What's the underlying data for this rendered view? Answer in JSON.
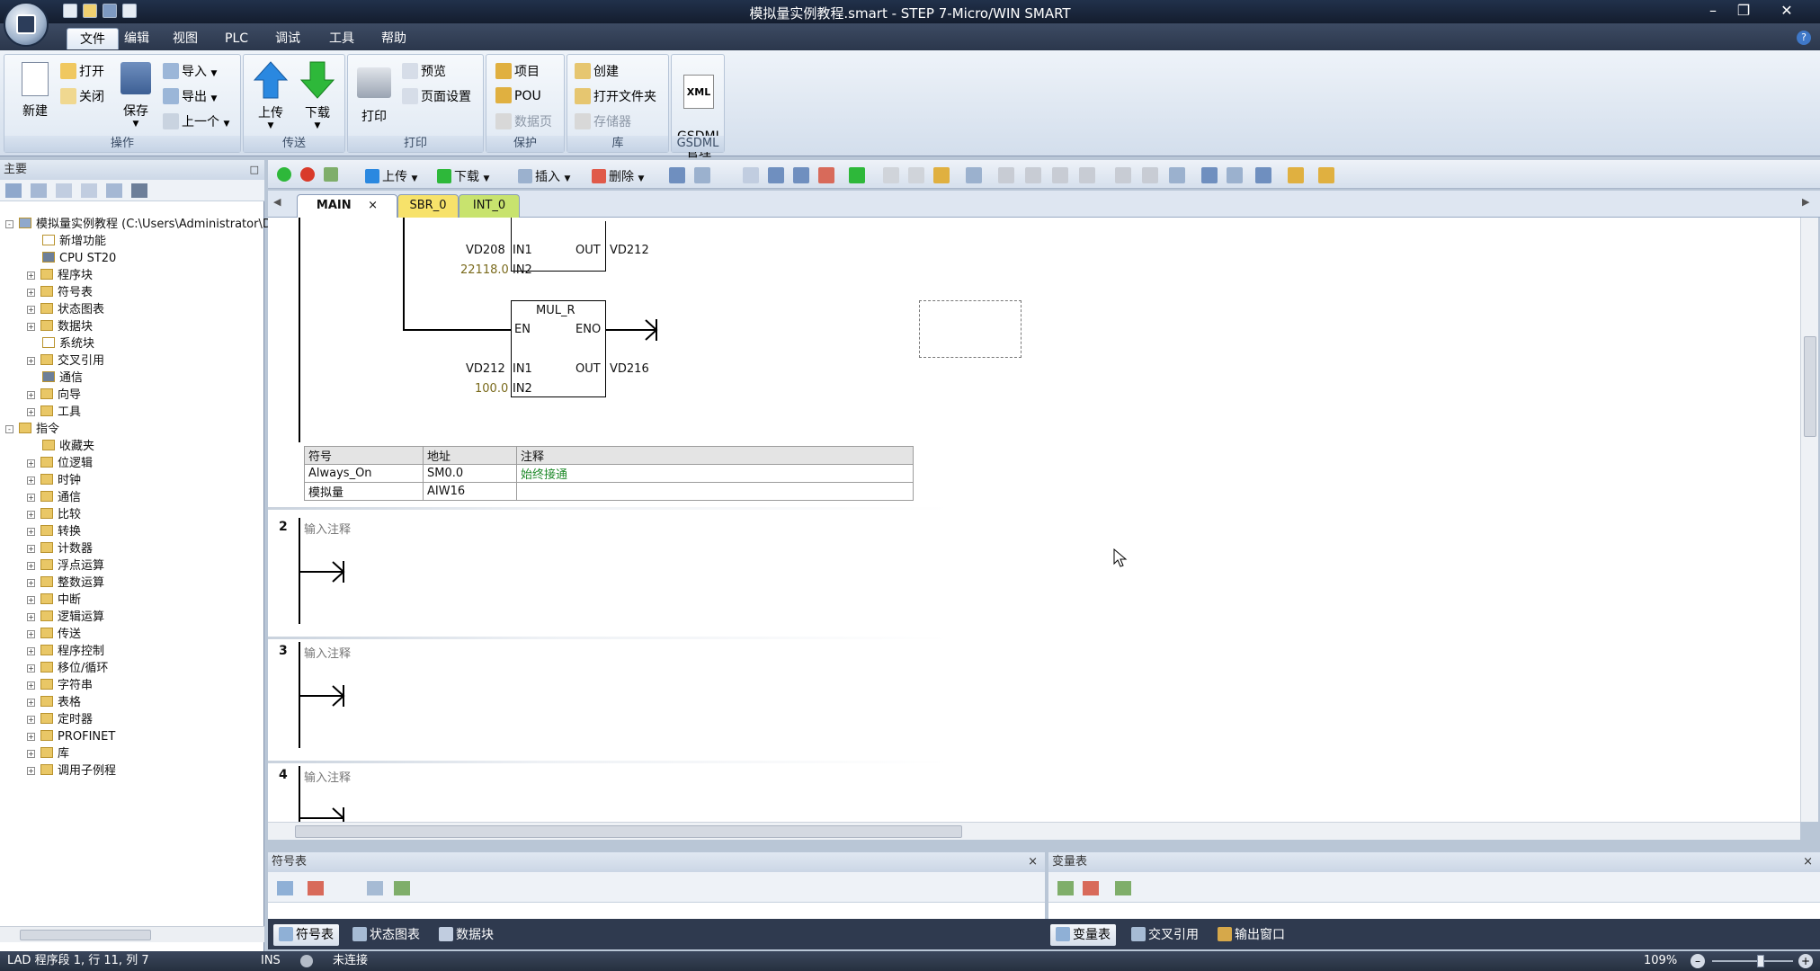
{
  "window": {
    "title": "模拟量实例教程.smart - STEP 7-Micro/WIN SMART"
  },
  "menu": {
    "tabs": [
      "文件",
      "编辑",
      "视图",
      "PLC",
      "调试",
      "工具",
      "帮助"
    ]
  },
  "ribbon": {
    "groups": {
      "operate": "操作",
      "transfer": "传送",
      "print": "打印",
      "protect": "保护",
      "library": "库",
      "gsdml": "GSDML"
    },
    "buttons": {
      "new": "新建",
      "open": "打开",
      "close": "关闭",
      "save": "保存",
      "import": "导入",
      "export": "导出",
      "previous": "上一个",
      "upload": "上传",
      "download": "下载",
      "print": "打印",
      "preview": "预览",
      "page_setup": "页面设置",
      "project": "项目",
      "pou": "POU",
      "data_page": "数据页",
      "create": "创建",
      "open_folder": "打开文件夹",
      "memory": "存储器",
      "gsdml_mgmt": "GSDML\n管理",
      "gsdml_xml": "XML"
    }
  },
  "left_panel": {
    "title": "主要",
    "tree": [
      {
        "label": "模拟量实例教程 (C:\\Users\\Administrator\\D",
        "level": 0,
        "expander": "-",
        "icon": "project"
      },
      {
        "label": "新增功能",
        "level": 1,
        "expander": "",
        "icon": "help"
      },
      {
        "label": "CPU ST20",
        "level": 1,
        "expander": "",
        "icon": "cpu"
      },
      {
        "label": "程序块",
        "level": 1,
        "expander": "+",
        "icon": "folder"
      },
      {
        "label": "符号表",
        "level": 1,
        "expander": "+",
        "icon": "folder"
      },
      {
        "label": "状态图表",
        "level": 1,
        "expander": "+",
        "icon": "folder"
      },
      {
        "label": "数据块",
        "level": 1,
        "expander": "+",
        "icon": "folder"
      },
      {
        "label": "系统块",
        "level": 1,
        "expander": "",
        "icon": "doc"
      },
      {
        "label": "交叉引用",
        "level": 1,
        "expander": "+",
        "icon": "folder"
      },
      {
        "label": "通信",
        "level": 1,
        "expander": "",
        "icon": "comm"
      },
      {
        "label": "向导",
        "level": 1,
        "expander": "+",
        "icon": "folder"
      },
      {
        "label": "工具",
        "level": 1,
        "expander": "+",
        "icon": "folder"
      },
      {
        "label": "指令",
        "level": 0,
        "expander": "-",
        "icon": "folder"
      },
      {
        "label": "收藏夹",
        "level": 1,
        "expander": "",
        "icon": "folder"
      },
      {
        "label": "位逻辑",
        "level": 1,
        "expander": "+",
        "icon": "folder"
      },
      {
        "label": "时钟",
        "level": 1,
        "expander": "+",
        "icon": "folder"
      },
      {
        "label": "通信",
        "level": 1,
        "expander": "+",
        "icon": "folder"
      },
      {
        "label": "比较",
        "level": 1,
        "expander": "+",
        "icon": "folder"
      },
      {
        "label": "转换",
        "level": 1,
        "expander": "+",
        "icon": "folder"
      },
      {
        "label": "计数器",
        "level": 1,
        "expander": "+",
        "icon": "folder"
      },
      {
        "label": "浮点运算",
        "level": 1,
        "expander": "+",
        "icon": "folder"
      },
      {
        "label": "整数运算",
        "level": 1,
        "expander": "+",
        "icon": "folder"
      },
      {
        "label": "中断",
        "level": 1,
        "expander": "+",
        "icon": "folder"
      },
      {
        "label": "逻辑运算",
        "level": 1,
        "expander": "+",
        "icon": "folder"
      },
      {
        "label": "传送",
        "level": 1,
        "expander": "+",
        "icon": "folder"
      },
      {
        "label": "程序控制",
        "level": 1,
        "expander": "+",
        "icon": "folder"
      },
      {
        "label": "移位/循环",
        "level": 1,
        "expander": "+",
        "icon": "folder"
      },
      {
        "label": "字符串",
        "level": 1,
        "expander": "+",
        "icon": "folder"
      },
      {
        "label": "表格",
        "level": 1,
        "expander": "+",
        "icon": "folder"
      },
      {
        "label": "定时器",
        "level": 1,
        "expander": "+",
        "icon": "folder"
      },
      {
        "label": "PROFINET",
        "level": 1,
        "expander": "+",
        "icon": "folder"
      },
      {
        "label": "库",
        "level": 1,
        "expander": "+",
        "icon": "folder"
      },
      {
        "label": "调用子例程",
        "level": 1,
        "expander": "+",
        "icon": "folder"
      }
    ]
  },
  "editor_toolbar": {
    "upload": "上传",
    "download": "下载",
    "insert": "插入",
    "delete": "删除"
  },
  "editor_tabs": [
    "MAIN",
    "SBR_0",
    "INT_0"
  ],
  "ladder": {
    "block1": {
      "in1": "VD208",
      "in2": "22118.0",
      "out": "VD212",
      "in1_pin": "IN1",
      "in2_pin": "IN2",
      "out_pin": "OUT"
    },
    "block2": {
      "name": "MUL_R",
      "en": "EN",
      "eno": "ENO",
      "in1": "VD212",
      "in2": "100.0",
      "out": "VD216",
      "in1_pin": "IN1",
      "in2_pin": "IN2",
      "out_pin": "OUT"
    },
    "symbol_table": {
      "headers": [
        "符号",
        "地址",
        "注释"
      ],
      "rows": [
        [
          "Always_On",
          "SM0.0",
          "始终接通"
        ],
        [
          "模拟量",
          "AIW16",
          ""
        ]
      ]
    },
    "rungs": [
      {
        "num": "2",
        "comment": "输入注释"
      },
      {
        "num": "3",
        "comment": "输入注释"
      },
      {
        "num": "4",
        "comment": "输入注释"
      }
    ]
  },
  "bottom": {
    "symbol_panel": "符号表",
    "var_panel": "变量表",
    "tabs_left": [
      "符号表",
      "状态图表",
      "数据块"
    ],
    "tabs_right": [
      "变量表",
      "交叉引用",
      "输出窗口"
    ]
  },
  "status": {
    "position": "LAD 程序段 1, 行 11, 列 7",
    "mode": "INS",
    "connection": "未连接",
    "zoom": "109%"
  }
}
